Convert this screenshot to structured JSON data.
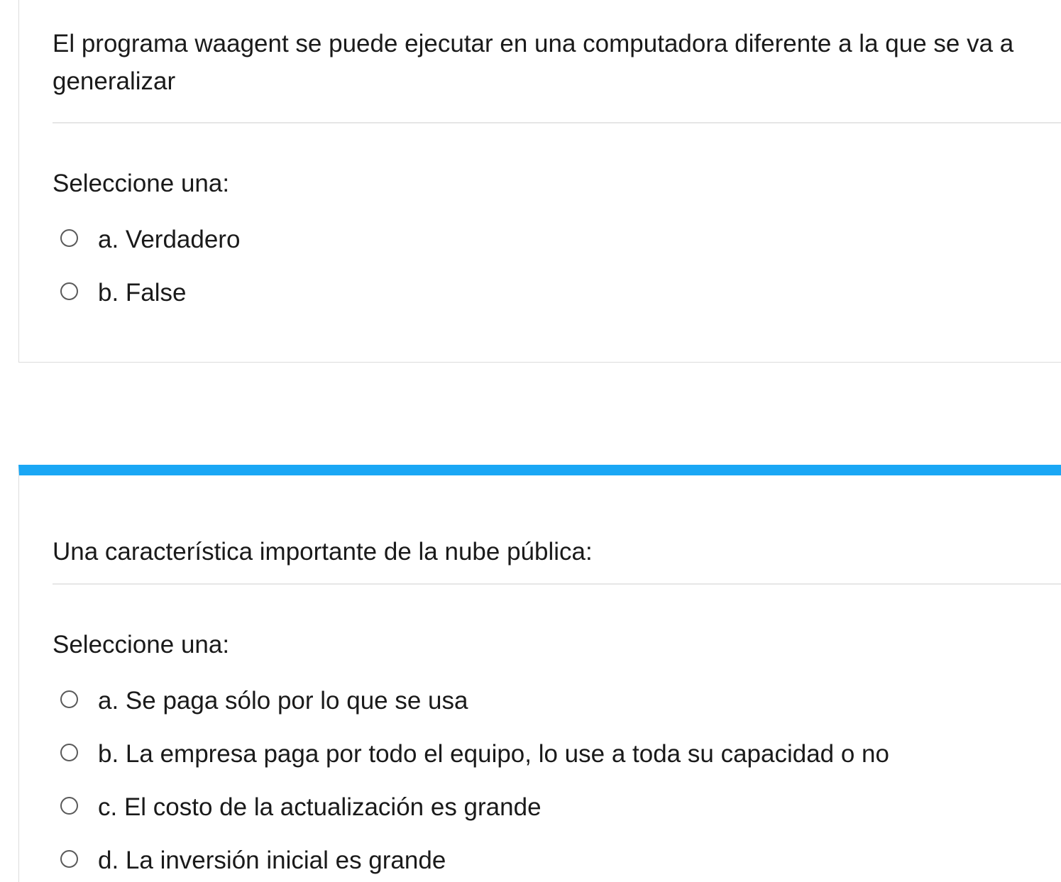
{
  "questions": [
    {
      "text": "El programa waagent se puede ejecutar en una computadora diferente a la que se va a generalizar",
      "prompt": "Seleccione una:",
      "answers": [
        {
          "label": "a. Verdadero",
          "selected": false
        },
        {
          "label": "b. False",
          "selected": false
        }
      ]
    },
    {
      "text": "Una característica importante de la nube pública:",
      "prompt": "Seleccione una:",
      "answers": [
        {
          "label": "a. Se paga sólo por lo que se usa",
          "selected": false
        },
        {
          "label": "b. La empresa paga por todo el equipo, lo use a toda su capacidad o no",
          "selected": false
        },
        {
          "label": "c. El costo de la actualización es grande",
          "selected": false
        },
        {
          "label": "d. La inversión inicial es grande",
          "selected": false
        }
      ]
    }
  ],
  "colors": {
    "accent": "#1aa7f5",
    "border": "#dcdcdc",
    "divider": "#e6e6e6",
    "radio_border": "#5a5a5a"
  }
}
